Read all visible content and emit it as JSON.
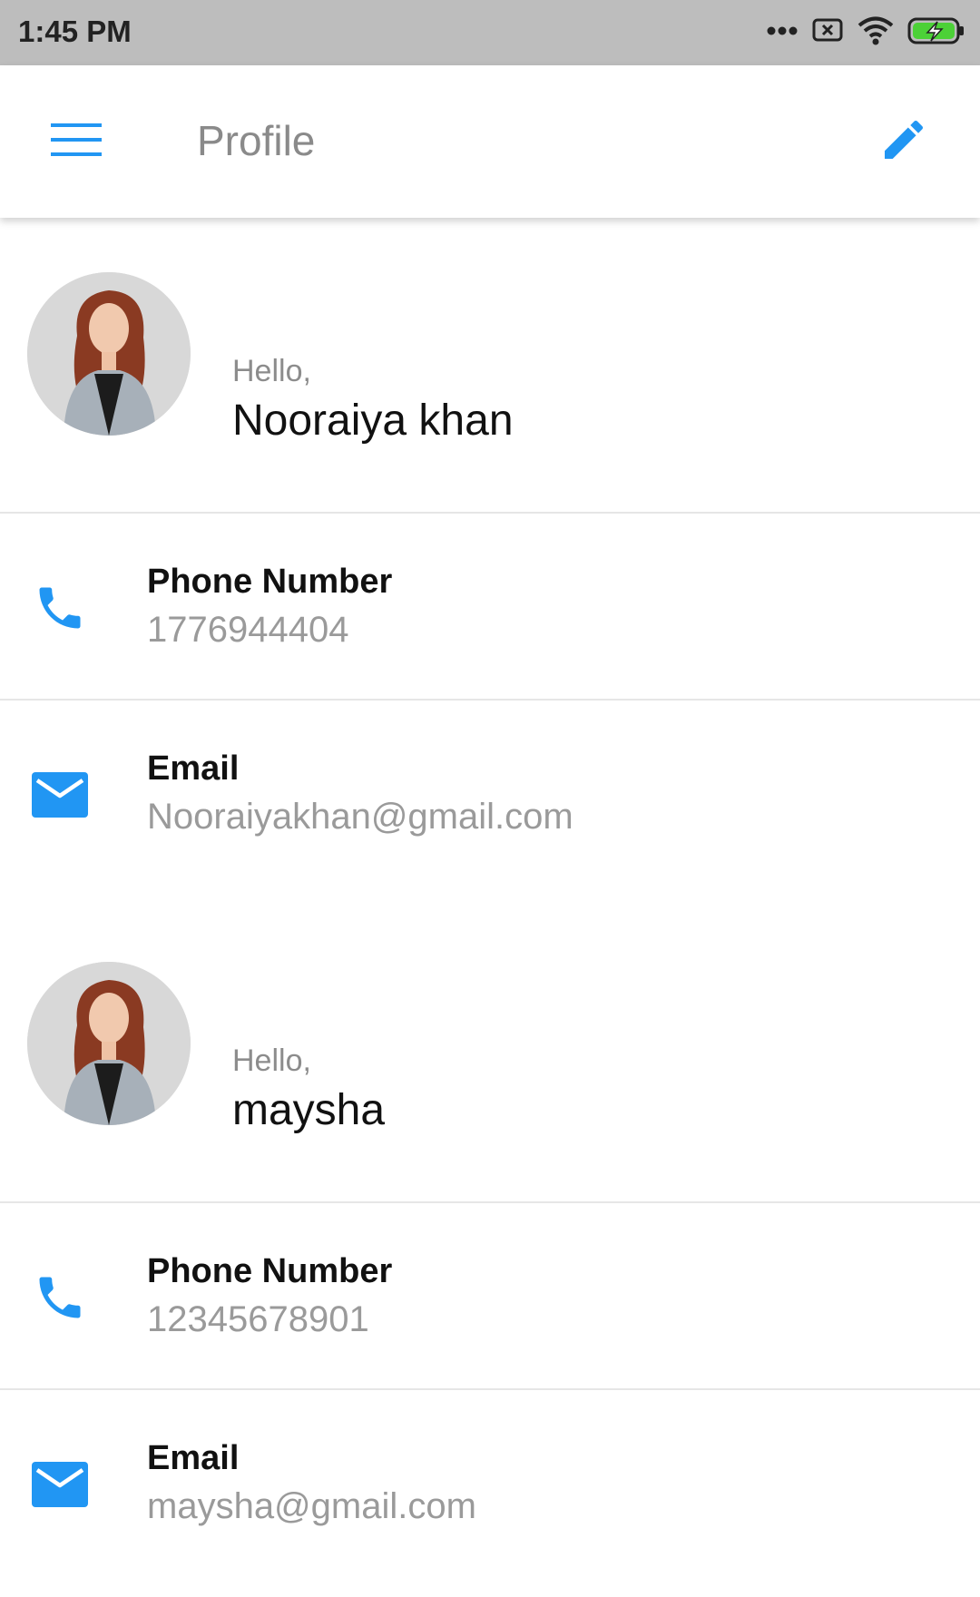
{
  "status_bar": {
    "time": "1:45 PM",
    "icons": [
      "more-dots-icon",
      "screen-record-icon",
      "wifi-icon",
      "battery-charging-icon"
    ]
  },
  "app_bar": {
    "title": "Profile",
    "menu_icon": "menu-icon",
    "edit_icon": "edit-pencil-icon"
  },
  "colors": {
    "accent": "#2196F3",
    "status_bar_bg": "#BDBDBD",
    "battery": "#4CD137"
  },
  "profiles": [
    {
      "greeting": "Hello,",
      "name": "Nooraiya khan",
      "phone_label": "Phone Number",
      "phone": "1776944404",
      "email_label": "Email",
      "email": "Nooraiyakhan@gmail.com"
    },
    {
      "greeting": "Hello,",
      "name": "maysha",
      "phone_label": "Phone Number",
      "phone": "12345678901",
      "email_label": "Email",
      "email": "maysha@gmail.com"
    }
  ]
}
